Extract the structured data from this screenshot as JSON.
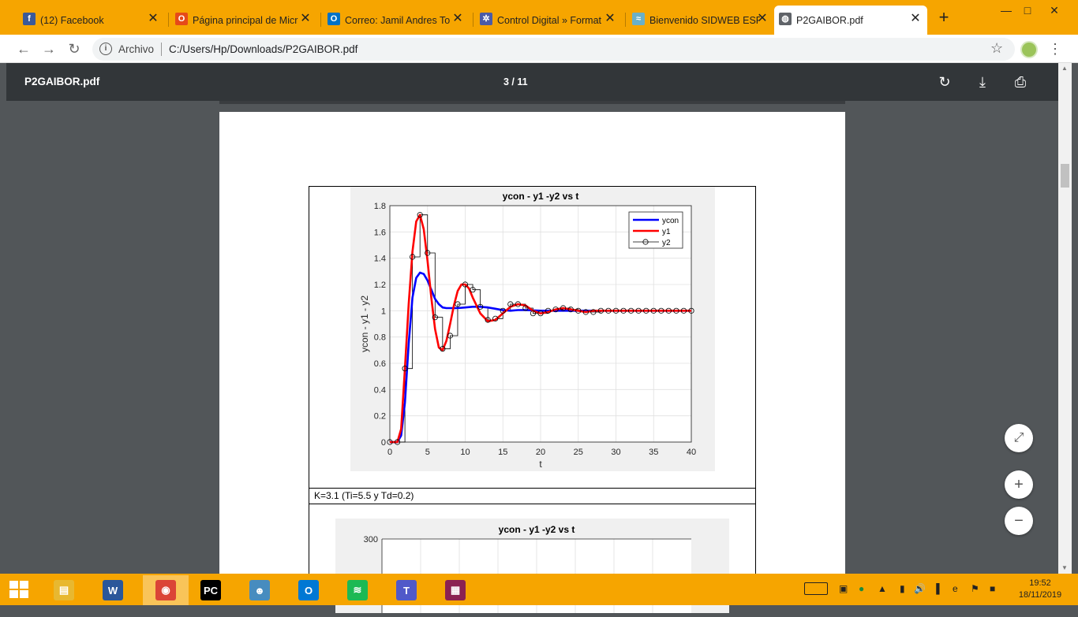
{
  "tabs": [
    {
      "title": "(12) Facebook",
      "fav_color": "#3b5998",
      "fav_glyph": "f"
    },
    {
      "title": "Página principal de Micr",
      "fav_color": "#e64a19",
      "fav_glyph": "O"
    },
    {
      "title": "Correo: Jamil Andres To",
      "fav_color": "#0072c6",
      "fav_glyph": "O"
    },
    {
      "title": "Control Digital » Format",
      "fav_color": "#4a5ba8",
      "fav_glyph": "✲"
    },
    {
      "title": "Bienvenido SIDWEB ESP",
      "fav_color": "#6ab0c8",
      "fav_glyph": "≈"
    },
    {
      "title": "P2GAIBOR.pdf",
      "fav_color": "#5f6368",
      "fav_glyph": "◍"
    }
  ],
  "omnibox": {
    "site_info": "Archivo",
    "url": "C:/Users/Hp/Downloads/P2GAIBOR.pdf"
  },
  "pdf": {
    "name": "P2GAIBOR.pdf",
    "page": "3 / 11"
  },
  "caption": "K=3.1 (Ti=5.5 y Td=0.2)",
  "chart_data": [
    {
      "type": "line",
      "title": "ycon - y1 -y2 vs t",
      "xlabel": "t",
      "ylabel": "ycon - y1 - y2",
      "xlim": [
        0,
        40
      ],
      "ylim": [
        0,
        1.8
      ],
      "xticks": [
        0,
        5,
        10,
        15,
        20,
        25,
        30,
        35,
        40
      ],
      "yticks": [
        0,
        0.2,
        0.4,
        0.6,
        0.8,
        1,
        1.2,
        1.4,
        1.6,
        1.8
      ],
      "grid": true,
      "legend": "top-right",
      "series": [
        {
          "name": "ycon",
          "color": "#0000ff",
          "x": [
            0,
            1,
            1.5,
            2,
            2.5,
            3,
            3.5,
            4,
            4.5,
            5,
            5.5,
            6,
            6.5,
            7,
            7.5,
            8,
            9,
            10,
            11,
            12,
            13,
            14,
            15,
            16,
            17,
            18,
            20,
            22,
            25,
            30,
            35,
            40
          ],
          "y": [
            0,
            0,
            0.05,
            0.3,
            0.75,
            1.1,
            1.25,
            1.29,
            1.28,
            1.23,
            1.16,
            1.09,
            1.05,
            1.025,
            1.02,
            1.02,
            1.02,
            1.025,
            1.03,
            1.03,
            1.025,
            1.015,
            1.005,
            1.0,
            1.005,
            1.005,
            1.0,
            1.0,
            1.0,
            1.0,
            1.0,
            1.0
          ]
        },
        {
          "name": "y1",
          "color": "#ff0000",
          "x": [
            0,
            1,
            1.5,
            2,
            2.5,
            3,
            3.5,
            4,
            4.5,
            5,
            5.5,
            6,
            6.5,
            7,
            7.5,
            8,
            8.5,
            9,
            9.5,
            10,
            10.5,
            11,
            12,
            13,
            14,
            15,
            16,
            17,
            18,
            19,
            20,
            21,
            22,
            23,
            24,
            25,
            26,
            27,
            28,
            30,
            35,
            40
          ],
          "y": [
            0,
            0,
            0.1,
            0.56,
            1.05,
            1.45,
            1.68,
            1.73,
            1.62,
            1.38,
            1.1,
            0.86,
            0.72,
            0.7,
            0.77,
            0.9,
            1.04,
            1.15,
            1.2,
            1.2,
            1.17,
            1.1,
            0.98,
            0.92,
            0.93,
            0.98,
            1.03,
            1.05,
            1.04,
            1.0,
            0.98,
            0.99,
            1.01,
            1.02,
            1.01,
            1.0,
            0.99,
            1.0,
            1.0,
            1.0,
            1.0,
            1.0
          ]
        },
        {
          "name": "y2",
          "color": "#000000",
          "x": [
            0,
            1,
            2,
            3,
            4,
            5,
            6,
            7,
            8,
            9,
            10,
            11,
            12,
            13,
            14,
            15,
            16,
            17,
            18,
            19,
            20,
            21,
            22,
            23,
            24,
            25,
            26,
            27,
            28,
            29,
            30,
            31,
            32,
            33,
            34,
            35,
            36,
            37,
            38,
            39,
            40
          ],
          "y": [
            0,
            0,
            0.56,
            1.41,
            1.73,
            1.44,
            0.95,
            0.71,
            0.81,
            1.05,
            1.2,
            1.16,
            1.03,
            0.93,
            0.94,
            1.0,
            1.05,
            1.05,
            1.02,
            0.98,
            0.98,
            1.0,
            1.01,
            1.02,
            1.01,
            1.0,
            0.99,
            0.99,
            1.0,
            1.0,
            1.0,
            1.0,
            1.0,
            1.0,
            1.0,
            1.0,
            1.0,
            1.0,
            1.0,
            1.0,
            1.0
          ]
        }
      ]
    },
    {
      "type": "line",
      "title": "ycon - y1 -y2 vs t",
      "yticks": [
        300
      ],
      "grid": true
    }
  ],
  "taskbar": {
    "apps": [
      {
        "name": "file-explorer",
        "color": "#e8b830",
        "glyph": "▤"
      },
      {
        "name": "word",
        "color": "#2b579a",
        "glyph": "W"
      },
      {
        "name": "chrome",
        "color": "#db4437",
        "glyph": "◉"
      },
      {
        "name": "pycharm",
        "color": "#000000",
        "glyph": "PC"
      },
      {
        "name": "godot",
        "color": "#478cbf",
        "glyph": "☻"
      },
      {
        "name": "outlook",
        "color": "#0078d4",
        "glyph": "O"
      },
      {
        "name": "spotify",
        "color": "#1db954",
        "glyph": "≋"
      },
      {
        "name": "teams",
        "color": "#5059c9",
        "glyph": "T"
      },
      {
        "name": "winrar",
        "color": "#8b2252",
        "glyph": "▦"
      }
    ],
    "time": "19:52",
    "date": "18/11/2019"
  }
}
